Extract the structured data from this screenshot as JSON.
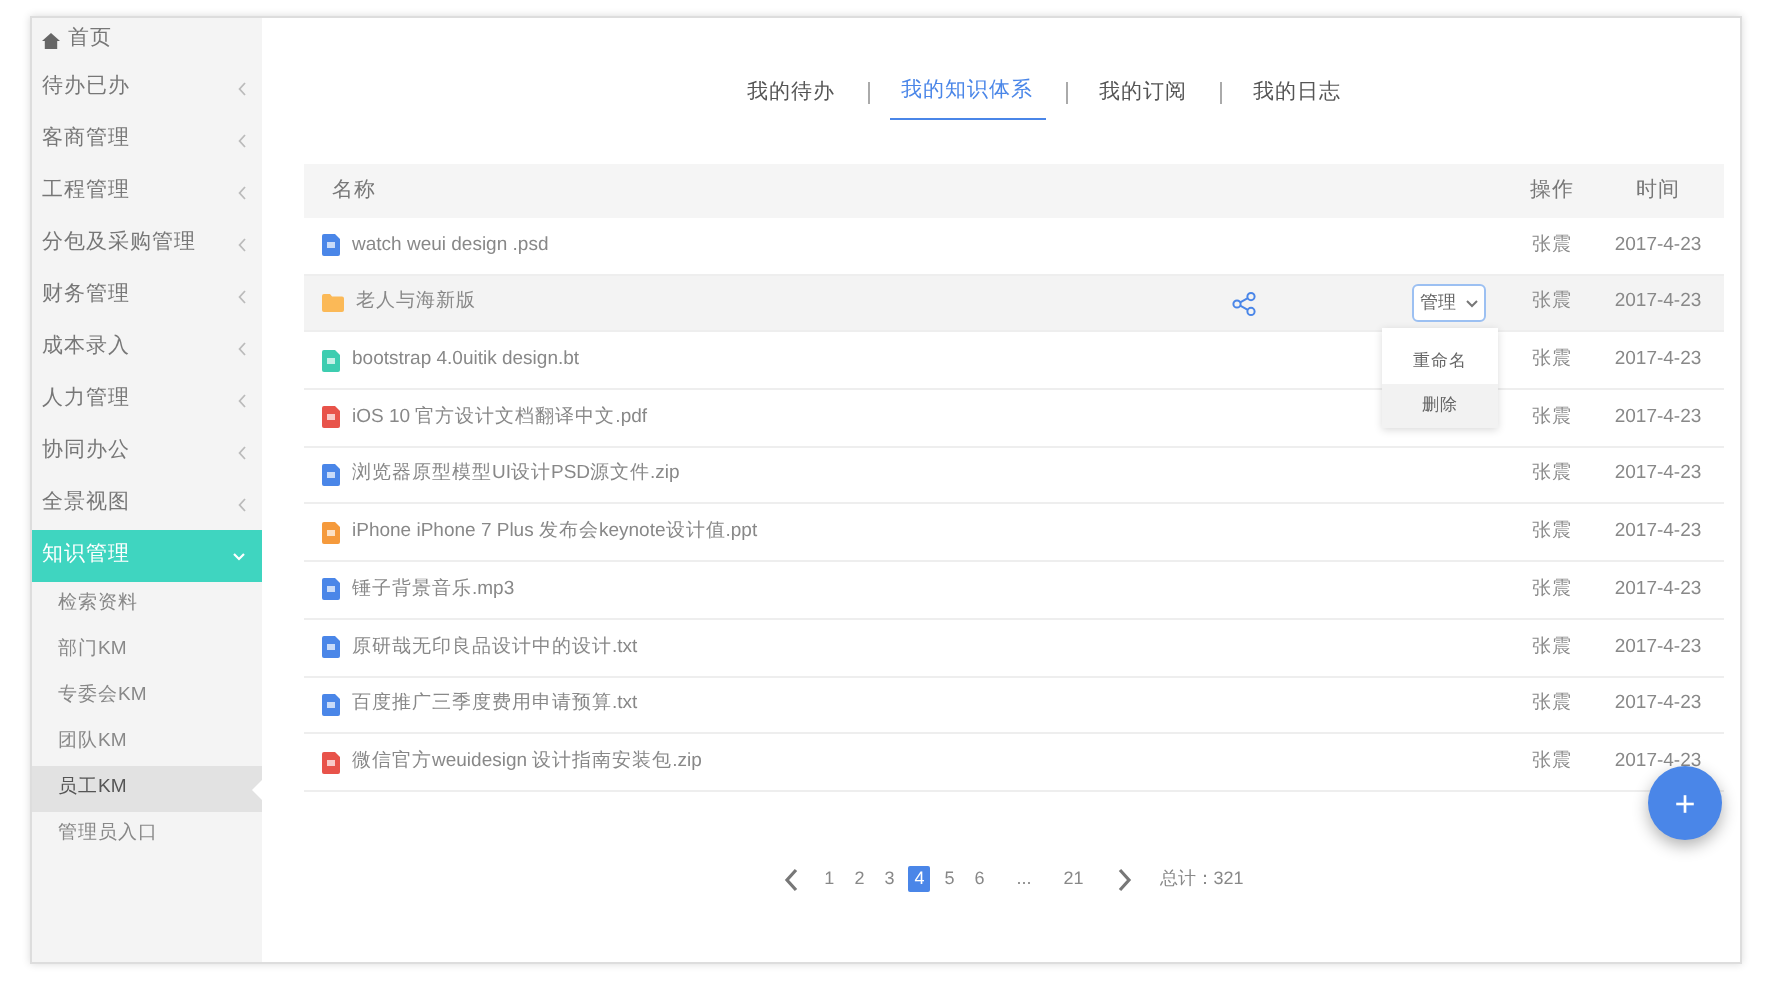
{
  "sidebar": {
    "home": {
      "label": "首页"
    },
    "items": [
      {
        "label": "待办已办",
        "expanded": false
      },
      {
        "label": "客商管理",
        "expanded": false
      },
      {
        "label": "工程管理",
        "expanded": false
      },
      {
        "label": "分包及采购管理",
        "expanded": false
      },
      {
        "label": "财务管理",
        "expanded": false
      },
      {
        "label": "成本录入",
        "expanded": false
      },
      {
        "label": "人力管理",
        "expanded": false
      },
      {
        "label": "协同办公",
        "expanded": false
      },
      {
        "label": "全景视图",
        "expanded": false
      },
      {
        "label": "知识管理",
        "expanded": true,
        "children": [
          {
            "label": "检索资料",
            "selected": false
          },
          {
            "label": "部门KM",
            "selected": false
          },
          {
            "label": "专委会KM",
            "selected": false
          },
          {
            "label": "团队KM",
            "selected": false
          },
          {
            "label": "员工KM",
            "selected": true
          },
          {
            "label": "管理员入口",
            "selected": false
          }
        ]
      }
    ]
  },
  "tabs": [
    {
      "label": "我的待办",
      "selected": false
    },
    {
      "label": "我的知识体系",
      "selected": true
    },
    {
      "label": "我的订阅",
      "selected": false
    },
    {
      "label": "我的日志",
      "selected": false
    }
  ],
  "table": {
    "columns": [
      "名称",
      "操作",
      "时间"
    ],
    "rows": [
      {
        "kind": "file",
        "color": "#4a86e8",
        "name": "watch weui design .psd",
        "owner": "张震",
        "date": "2017-4-23",
        "selected": false
      },
      {
        "kind": "folder",
        "color": "#fbb957",
        "name": "老人与海新版",
        "owner": "张震",
        "date": "2017-4-23",
        "selected": true,
        "actions": {
          "button": "管理",
          "open": true,
          "menu": [
            {
              "label": "重命名",
              "highlighted": false
            },
            {
              "label": "删除",
              "highlighted": true
            }
          ]
        }
      },
      {
        "kind": "file",
        "color": "#3dcdb0",
        "name": "bootstrap 4.0uitik design.bt",
        "owner": "张震",
        "date": "2017-4-23",
        "selected": false
      },
      {
        "kind": "file",
        "color": "#e8534a",
        "name": "iOS 10 官方设计文档翻译中文.pdf",
        "owner": "张震",
        "date": "2017-4-23",
        "selected": false
      },
      {
        "kind": "file",
        "color": "#4a86e8",
        "name": "浏览器原型模型UI设计PSD源文件.zip",
        "owner": "张震",
        "date": "2017-4-23",
        "selected": false
      },
      {
        "kind": "file",
        "color": "#f59a3c",
        "name": "iPhone iPhone 7 Plus 发布会keynote设计值.ppt",
        "owner": "张震",
        "date": "2017-4-23",
        "selected": false
      },
      {
        "kind": "file",
        "color": "#4a86e8",
        "name": "锤子背景音乐.mp3",
        "owner": "张震",
        "date": "2017-4-23",
        "selected": false
      },
      {
        "kind": "file",
        "color": "#4a86e8",
        "name": "原研哉无印良品设计中的设计.txt",
        "owner": "张震",
        "date": "2017-4-23",
        "selected": false
      },
      {
        "kind": "file",
        "color": "#4a86e8",
        "name": "百度推广三季度费用申请预算.txt",
        "owner": "张震",
        "date": "2017-4-23",
        "selected": false
      },
      {
        "kind": "file",
        "color": "#e8534a",
        "name": "微信官方weuidesign 设计指南安装包.zip",
        "owner": "张震",
        "date": "2017-4-23",
        "selected": false
      }
    ]
  },
  "pagination": {
    "pages": [
      {
        "label": "1",
        "selected": false
      },
      {
        "label": "2",
        "selected": false
      },
      {
        "label": "3",
        "selected": false
      },
      {
        "label": "4",
        "selected": true
      },
      {
        "label": "5",
        "selected": false
      },
      {
        "label": "6",
        "selected": false
      },
      {
        "label": "...",
        "selected": false
      },
      {
        "label": "21",
        "selected": false
      }
    ],
    "total": "总计：321"
  },
  "fab": "+"
}
